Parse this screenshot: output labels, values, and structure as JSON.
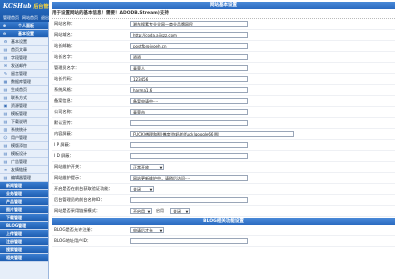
{
  "header": {
    "logo": "KCSHub",
    "logo_suffix": "后台管理",
    "nav": [
      "管理首页",
      "网站首页",
      "退出"
    ]
  },
  "sidebar": {
    "items": [
      {
        "label": "个人面板",
        "type": "group",
        "icon": "plus"
      },
      {
        "label": "基本设置",
        "type": "group",
        "icon": "minus"
      },
      {
        "label": "基本设置",
        "type": "item",
        "icon": "gear"
      },
      {
        "label": "首页文章",
        "type": "item",
        "icon": "page"
      },
      {
        "label": "字段管理",
        "type": "item",
        "icon": "page"
      },
      {
        "label": "发送邮件",
        "type": "item",
        "icon": "mail"
      },
      {
        "label": "留言管理",
        "type": "item",
        "icon": "chat"
      },
      {
        "label": "数据库管理",
        "type": "item",
        "icon": "db"
      },
      {
        "label": "生成首页",
        "type": "item",
        "icon": "page"
      },
      {
        "label": "联系方式",
        "type": "item",
        "icon": "page"
      },
      {
        "label": "资源管理",
        "type": "item",
        "icon": "folder"
      },
      {
        "label": "模板管理",
        "type": "item",
        "icon": "page"
      },
      {
        "label": "下载说明",
        "type": "item",
        "icon": "page"
      },
      {
        "label": "系统统计",
        "type": "item",
        "icon": "chart"
      },
      {
        "label": "用户管理",
        "type": "item",
        "icon": "user"
      },
      {
        "label": "模版添加",
        "type": "item",
        "icon": "page"
      },
      {
        "label": "模板设计",
        "type": "item",
        "icon": "page"
      },
      {
        "label": "广告管理",
        "type": "item",
        "icon": "page"
      },
      {
        "label": "友情链接",
        "type": "item",
        "icon": "link"
      },
      {
        "label": "编辑器管理",
        "type": "item",
        "icon": "page"
      },
      {
        "label": "新闻管理",
        "type": "cat",
        "icon": ""
      },
      {
        "label": "业务管理",
        "type": "cat",
        "icon": ""
      },
      {
        "label": "产品管理",
        "type": "cat",
        "icon": ""
      },
      {
        "label": "图片管理",
        "type": "cat",
        "icon": ""
      },
      {
        "label": "下载管理",
        "type": "cat",
        "icon": ""
      },
      {
        "label": "BLOG管理",
        "type": "cat",
        "icon": ""
      },
      {
        "label": "上传管理",
        "type": "cat",
        "icon": ""
      },
      {
        "label": "注册管理",
        "type": "cat",
        "icon": ""
      },
      {
        "label": "搜索管理",
        "type": "cat",
        "icon": ""
      },
      {
        "label": "相关管理",
        "type": "cat",
        "icon": ""
      }
    ]
  },
  "main": {
    "title": "网站基本设置",
    "notice": "用于设置网站的基本信息！需要！ADODB.Stream)支持",
    "rows": [
      {
        "label": "网站名称：",
        "value": "湘东搜素专业全网—商业品牌网民",
        "size": "wide"
      },
      {
        "label": "网站域名：",
        "value": "http://coda.aijszz.com",
        "size": "wide"
      },
      {
        "label": "站长邮箱：",
        "value": "postfb@jyoeh.cn",
        "size": "wide"
      },
      {
        "label": "站长名字：",
        "value": "骄骄",
        "size": "wide"
      },
      {
        "label": "管理员名字：",
        "value": "青荣人",
        "size": "wide"
      },
      {
        "label": "站长代码：",
        "value": "123456",
        "size": "wide"
      },
      {
        "label": "系统风格：",
        "value": "harma1.6",
        "size": "wide"
      },
      {
        "label": "备案信息：",
        "value": "备案申请中····",
        "size": "wide"
      },
      {
        "label": "公司名称：",
        "value": "青荣市",
        "size": "wide"
      },
      {
        "label": "默认宣传：",
        "value": "",
        "size": "wide"
      },
      {
        "label": "内容屏蔽：",
        "value": "FUCK|傅理和那|傅度|你妈的|fuck|google66|那",
        "size": "long"
      },
      {
        "label": "I P 屏蔽：",
        "value": "",
        "size": "wide"
      },
      {
        "label": "I D 屏蔽：",
        "value": "",
        "size": "wide"
      }
    ],
    "status_label": "网站维护开关：",
    "status_value": "正常开放",
    "maintenance_label": "网站维护提示：",
    "maintenance_value": "网站更新维护中，请稍后访问····",
    "open_label": "开启是否在前台获取验证功能：",
    "open_value": "关闭",
    "code_label": "后台管理员的前台名称ID：",
    "code_value": "",
    "mode_label": "网站是否采用链接模式：",
    "mode_option": "不启用",
    "mode_option2": "启用",
    "mode_value": "关闭",
    "blog_section": "BLOG相关功能设置",
    "blog_rows": [
      {
        "label": "BLOG是否允许注册：",
        "value": "申请后才允"
      },
      {
        "label": "BLOG地址用户ID：",
        "value": ""
      }
    ]
  }
}
